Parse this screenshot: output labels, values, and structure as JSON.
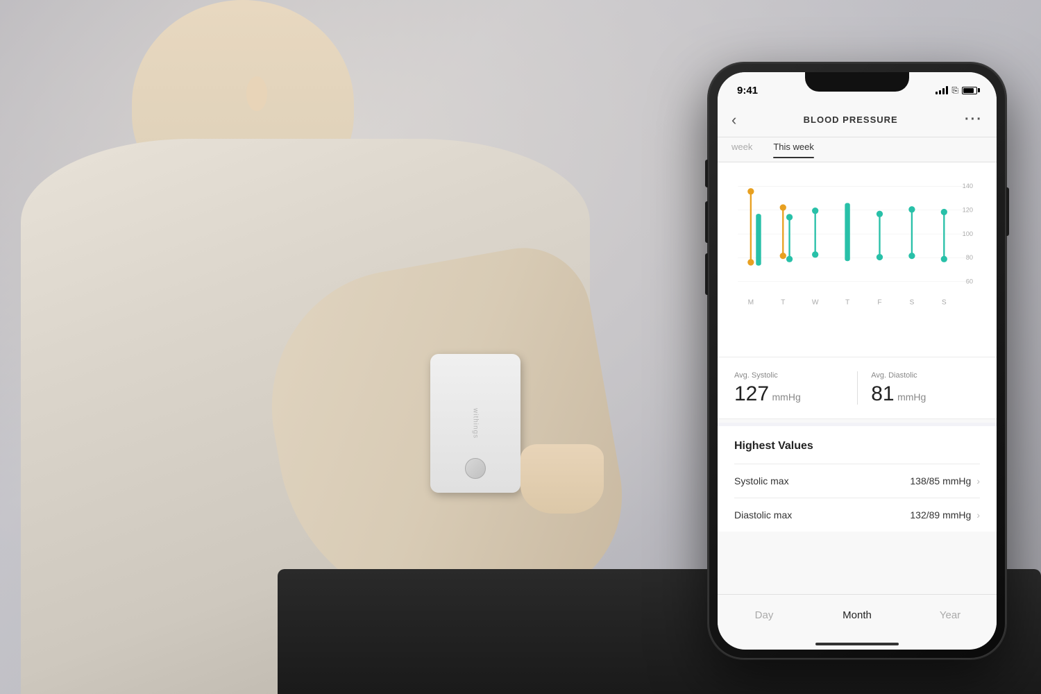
{
  "background": {
    "color": "#c5c5ca"
  },
  "phone": {
    "status_bar": {
      "time": "9:41",
      "signal_label": "signal",
      "wifi_label": "wifi",
      "battery_label": "battery"
    },
    "header": {
      "back_label": "‹",
      "title": "BLOOD PRESSURE",
      "more_label": "···"
    },
    "tabs": [
      {
        "label": "week",
        "active": false
      },
      {
        "label": "This week",
        "active": true
      }
    ],
    "chart": {
      "y_labels": [
        "140",
        "120",
        "100",
        "80",
        "60"
      ],
      "x_labels": [
        "M",
        "T",
        "W",
        "T",
        "F",
        "S",
        "S"
      ]
    },
    "stats": {
      "systolic_label": "Avg. Systolic",
      "systolic_value": "127",
      "systolic_unit": "mmHg",
      "diastolic_label": "Avg. Diastolic",
      "diastolic_value": "81",
      "diastolic_unit": "mmHg"
    },
    "highest_values": {
      "title": "Highest Values",
      "rows": [
        {
          "label": "Systolic max",
          "value": "138/85 mmHg"
        },
        {
          "label": "Diastolic max",
          "value": "132/89 mmHg"
        }
      ]
    },
    "time_tabs": [
      {
        "label": "Day",
        "active": false
      },
      {
        "label": "Month",
        "active": true
      },
      {
        "label": "Year",
        "active": false
      }
    ],
    "colors": {
      "orange": "#e8a020",
      "teal": "#28c0a8",
      "accent": "#28c0a8"
    }
  }
}
